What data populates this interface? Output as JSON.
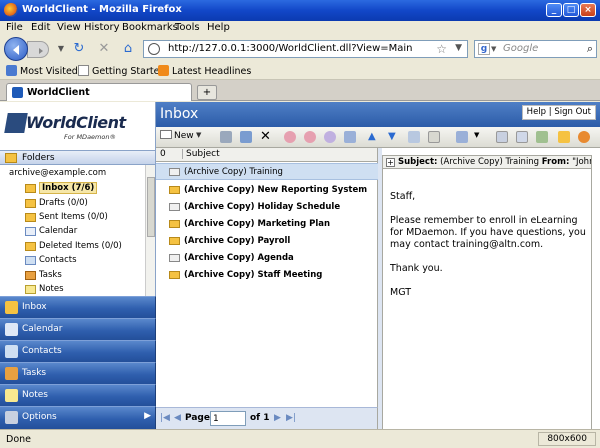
{
  "window": {
    "title": "WorldClient - Mozilla Firefox",
    "min": "_",
    "max": "□",
    "close": "×"
  },
  "menu": [
    "File",
    "Edit",
    "View",
    "History",
    "Bookmarks",
    "Tools",
    "Help"
  ],
  "nav": {
    "url": "http://127.0.0.1:3000/WorldClient.dll?View=Main",
    "search_placeholder": "Google"
  },
  "bookmarks": [
    "Most Visited",
    "Getting Started",
    "Latest Headlines"
  ],
  "tab": {
    "label": "WorldClient",
    "new": "+"
  },
  "app": {
    "logo": "WorldClient",
    "logo_sub": "For MDaemon®",
    "folders_label": "Folders",
    "tree": [
      {
        "label": "archive@example.com",
        "icon": "account-icon"
      },
      {
        "label": "Inbox (7/6)",
        "icon": "inbox-icon",
        "selected": true
      },
      {
        "label": "Drafts (0/0)",
        "icon": "drafts-icon"
      },
      {
        "label": "Sent Items (0/0)",
        "icon": "sent-icon"
      },
      {
        "label": "Calendar",
        "icon": "calendar-icon"
      },
      {
        "label": "Deleted Items (0/0)",
        "icon": "trash-icon"
      },
      {
        "label": "Contacts",
        "icon": "contacts-icon"
      },
      {
        "label": "Tasks",
        "icon": "tasks-icon"
      },
      {
        "label": "Notes",
        "icon": "notes-icon"
      }
    ],
    "nav_buttons": [
      "Inbox",
      "Calendar",
      "Contacts",
      "Tasks",
      "Notes",
      "Options"
    ],
    "inbox_title": "Inbox",
    "help": "Help",
    "sep": "|",
    "signout": "Sign Out",
    "new_label": "New",
    "list_clip": "0",
    "list_header": "Subject",
    "messages": [
      {
        "subject": "(Archive Copy) Training",
        "selected": true,
        "bold": false,
        "unread": false
      },
      {
        "subject": "(Archive Copy) New Reporting System",
        "bold": true,
        "unread": true
      },
      {
        "subject": "(Archive Copy) Holiday Schedule",
        "bold": true,
        "unread": false
      },
      {
        "subject": "(Archive Copy) Marketing Plan",
        "bold": true,
        "unread": true
      },
      {
        "subject": "(Archive Copy) Payroll",
        "bold": true,
        "unread": true
      },
      {
        "subject": "(Archive Copy) Agenda",
        "bold": true,
        "unread": false
      },
      {
        "subject": "(Archive Copy) Staff Meeting",
        "bold": true,
        "unread": true
      }
    ],
    "pager": {
      "page_label": "Page",
      "page_value": "1",
      "of_label": "of 1"
    },
    "preview": {
      "plus": "+",
      "subject_label": "Subject:",
      "subject": "(Archive Copy) Training",
      "from_label": "From:",
      "from": "\"John Smith\"",
      "greeting": "Staff,",
      "body": "Please remember to enroll in eLearning for MDaemon. If you have questions, you may contact training@altn.com.",
      "thanks": "Thank you.",
      "signature": "MGT"
    }
  },
  "status": {
    "text": "Done",
    "resolution": "800x600"
  }
}
